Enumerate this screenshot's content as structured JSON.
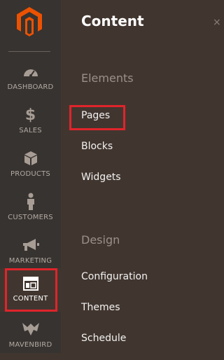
{
  "sidebar": {
    "items": [
      {
        "label": "DASHBOARD",
        "icon": "dashboard-icon"
      },
      {
        "label": "SALES",
        "icon": "dollar-icon"
      },
      {
        "label": "PRODUCTS",
        "icon": "box-icon"
      },
      {
        "label": "CUSTOMERS",
        "icon": "person-icon"
      },
      {
        "label": "MARKETING",
        "icon": "megaphone-icon"
      },
      {
        "label": "CONTENT",
        "icon": "layout-icon"
      },
      {
        "label": "MAVENBIRD",
        "icon": "mavenbird-icon"
      }
    ]
  },
  "panel": {
    "title": "Content",
    "sections": [
      {
        "title": "Elements",
        "links": [
          "Pages",
          "Blocks",
          "Widgets"
        ]
      },
      {
        "title": "Design",
        "links": [
          "Configuration",
          "Themes",
          "Schedule"
        ]
      }
    ]
  },
  "colors": {
    "accent": "#e0242b",
    "logo": "#eb5202",
    "rail_bg": "#373330",
    "panel_bg": "#41362f"
  }
}
